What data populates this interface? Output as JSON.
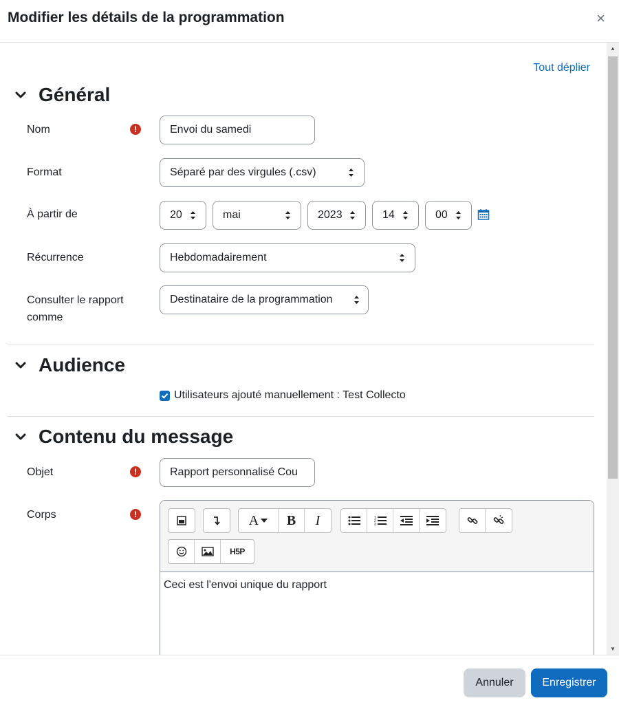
{
  "header": {
    "title": "Modifier les détails de la programmation",
    "close": "×"
  },
  "expand_all": "Tout déplier",
  "general": {
    "title": "Général",
    "name_label": "Nom",
    "name_value": "Envoi du samedi",
    "format_label": "Format",
    "format_value": "Séparé par des virgules (.csv)",
    "from_label": "À partir de",
    "from_day": "20",
    "from_month": "mai",
    "from_year": "2023",
    "from_hour": "14",
    "from_minute": "00",
    "recurrence_label": "Récurrence",
    "recurrence_value": "Hebdomadairement",
    "view_as_label_1": "Consulter le rapport",
    "view_as_label_2": "comme",
    "view_as_value": "Destinataire de la programmation"
  },
  "audience": {
    "title": "Audience",
    "checkbox_label": "Utilisateurs ajouté manuellement : Test Collecto",
    "checked": true
  },
  "message": {
    "title": "Contenu du message",
    "subject_label": "Objet",
    "subject_value": "Rapport personnalisé Cou",
    "body_label": "Corps",
    "body_text": "Ceci est l'envoi unique du rapport",
    "toolbar_icons": [
      "media-icon",
      "toggle-toolbar-icon",
      "font-color-icon",
      "bold-icon",
      "italic-icon",
      "unordered-list-icon",
      "ordered-list-icon",
      "outdent-icon",
      "indent-icon",
      "link-icon",
      "unlink-icon",
      "emoji-icon",
      "image-icon",
      "h5p-icon"
    ],
    "toolbar_text": {
      "font": "A",
      "bold": "B",
      "italic": "I",
      "h5p": "H5P"
    }
  },
  "footer": {
    "cancel": "Annuler",
    "save": "Enregistrer"
  },
  "colors": {
    "accent": "#0f6cbf",
    "required": "#ca3120",
    "cancel_bg": "#ced4da"
  }
}
